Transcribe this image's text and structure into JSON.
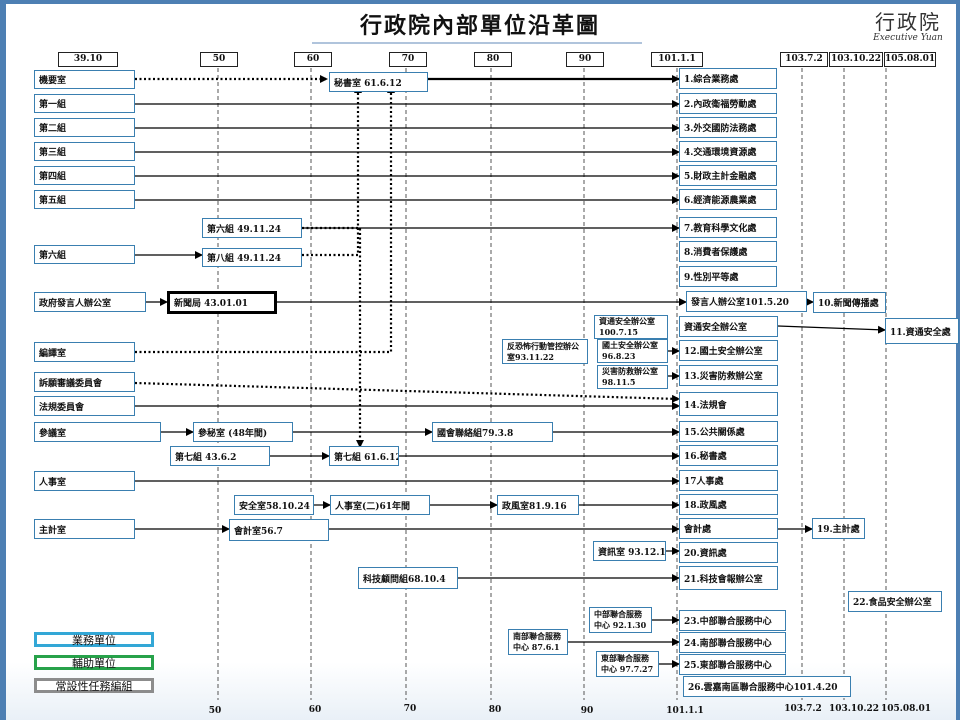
{
  "header": {
    "title": "行政院內部單位沿革圖",
    "logo_zh": "行政院",
    "logo_en": "Executive Yuan"
  },
  "timeline_top": [
    "39.10",
    "50",
    "60",
    "70",
    "80",
    "90",
    "101.1.1",
    "103.7.2",
    "103.10.22",
    "105.08.01"
  ],
  "timeline_bottom": [
    "50",
    "60",
    "70",
    "80",
    "90",
    "101.1.1",
    "103.7.2",
    "103.10.22",
    "105.08.01"
  ],
  "left_units": {
    "jiyao": "機要室",
    "zu1": "第一組",
    "zu2": "第二組",
    "zu3": "第三組",
    "zu4": "第四組",
    "zu5": "第五組",
    "zu6": "第六組",
    "govspokes": "政府發言人辦公室",
    "bianyi": "編譯室",
    "suyuan": "訴願審議委員會",
    "fagui": "法規委員會",
    "canyi": "參議室",
    "renshi": "人事室",
    "zhuji": "主計室"
  },
  "middle_units": {
    "mishu_room": "秘書室 61.6.12",
    "zu6_4911": "第六組 49.11.24",
    "zu8_4911": "第八組 49.11.24",
    "xinwenju": "新聞局 43.01.01",
    "canmi": "參秘室 (48年間)",
    "zu7_4362": "第七組 43.6.2",
    "zu7_61612": "第七組 61.6.12",
    "guohui": "國會聯絡組79.3.8",
    "anquan": "安全室58.10.24",
    "renshi2": "人事室(二)61年間",
    "zhengfeng": "政風室81.9.16",
    "kuaiji": "會計室56.7",
    "keji_guwen": "科技顧問組68.10.4",
    "zixun_anquan_1007": "資通安全辦公室 100.7.15",
    "fankong": "反恐怖行動管控辦公室93.11.22",
    "guotu_anquan": "國土安全辦公室 96.8.23",
    "zaihai": "災害防救辦公室98.11.5",
    "zixun_room": "資訊室 93.12.1",
    "zhongbu_center": "中部聯合服務中心 92.1.30",
    "nanbu_center": "南部聯合服務中心 87.6.1",
    "dongbu_center": "東部聯合服務中心 97.7.27"
  },
  "current_units": [
    "1.綜合業務處",
    "2.內政衛福勞動處",
    "3.外交國防法務處",
    "4.交通環境資源處",
    "5.財政主計金融處",
    "6.經濟能源農業處",
    "7.教育科學文化處",
    "8.消費者保護處",
    "9.性別平等處",
    "發言人辦公室101.5.20",
    "資通安全辦公室",
    "12.國土安全辦公室",
    "13.災害防救辦公室",
    "14.法規會",
    "15.公共關係處",
    "16.秘書處",
    "17人事處",
    "18.政風處",
    "會計處",
    "20.資訊處",
    "21.科技會報辦公室",
    "23.中部聯合服務中心",
    "24.南部聯合服務中心",
    "25.東部聯合服務中心",
    "26.雲嘉南區聯合服務中心101.4.20"
  ],
  "later_units": {
    "xinwen": "10.新聞傳播處",
    "zixun_anquan": "11.資通安全處",
    "zhuji_chu": "19.主計處",
    "food_safety": "22.食品安全辦公室"
  },
  "legend": {
    "business": "業務單位",
    "support": "輔助單位",
    "task": "常設性任務編組"
  },
  "colors": {
    "business_border": "#33a7d6",
    "support_border": "#27a24a",
    "task_border": "#8c8c8c",
    "frame": "#4d7fb3"
  }
}
